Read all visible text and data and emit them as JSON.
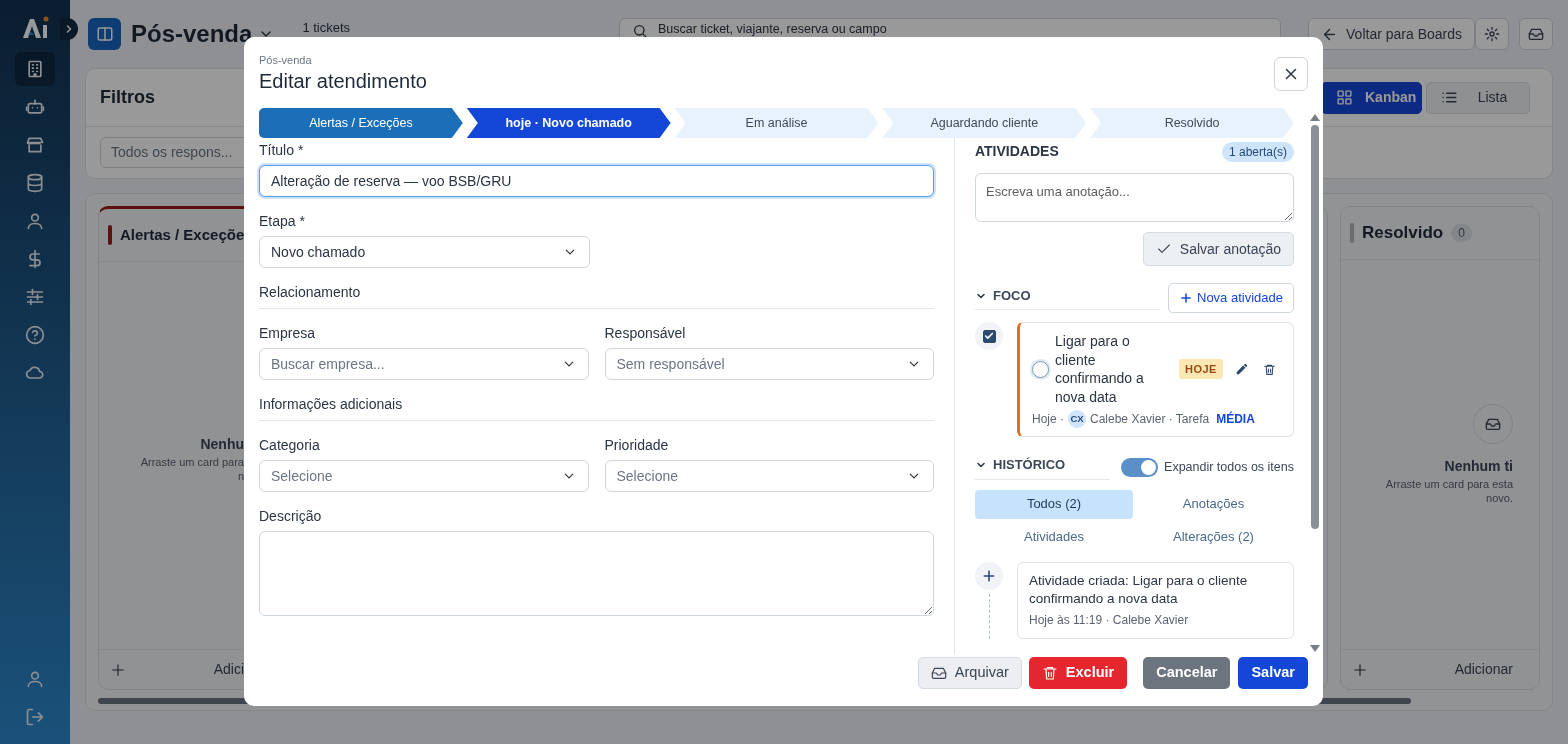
{
  "sidebar": {
    "items": [
      {
        "selected": true
      },
      {
        "selected": false
      },
      {
        "selected": false
      },
      {
        "selected": false
      },
      {
        "selected": false
      },
      {
        "selected": false
      },
      {
        "selected": false
      },
      {
        "selected": false
      },
      {
        "selected": false
      }
    ],
    "bottom_items": [
      {
        "selected": false
      },
      {
        "selected": false
      }
    ]
  },
  "header": {
    "board_title": "Pós-venda",
    "ticket_count": "1 tickets",
    "search_placeholder": "Buscar ticket, viajante, reserva ou campo",
    "back_button": "Voltar para Boards"
  },
  "filters": {
    "title": "Filtros",
    "responsible_select": "Todos os respons...",
    "views": [
      {
        "label": "Kanban",
        "selected": true
      },
      {
        "label": "Lista",
        "selected": false
      }
    ]
  },
  "board": {
    "columns": [
      {
        "title": "Alertas / Exceçõe",
        "color": "#5d1111",
        "empty_title": "Nenhu",
        "empty_lines": [
          "Arraste um card para",
          "n"
        ],
        "add_label": "Adici"
      },
      {
        "title": "Resolvido",
        "count": "0",
        "color": "#686d71",
        "empty_title": "Nenhum ti",
        "empty_lines": [
          "Arraste um card para esta",
          "novo."
        ],
        "add_label": "Adicionar"
      }
    ]
  },
  "modal": {
    "breadcrumb": "Pós-venda",
    "title": "Editar atendimento",
    "steps": [
      {
        "label": "Alertas / Exceções",
        "completed": true,
        "selected": false
      },
      {
        "label": "hoje · Novo chamado",
        "completed": false,
        "selected": true
      },
      {
        "label": "Em análise",
        "completed": false,
        "selected": false
      },
      {
        "label": "Aguardando cliente",
        "completed": false,
        "selected": false
      },
      {
        "label": "Resolvido",
        "completed": false,
        "selected": false
      }
    ],
    "title_field": {
      "label": "Título *",
      "value": "Alteração de reserva — voo BSB/GRU",
      "focused": true
    },
    "stage_field": {
      "label": "Etapa *",
      "value": "Novo chamado"
    },
    "sections": [
      {
        "heading": "Relacionamento",
        "fields": [
          {
            "label": "Empresa",
            "placeholder": "Buscar empresa..."
          },
          {
            "label": "Responsável",
            "placeholder": "Sem responsável"
          }
        ]
      },
      {
        "heading": "Informações adicionais",
        "fields": [
          {
            "label": "Categoria",
            "placeholder": "Selecione"
          },
          {
            "label": "Prioridade",
            "placeholder": "Selecione"
          }
        ]
      }
    ],
    "description_field": {
      "label": "Descrição"
    },
    "activities": {
      "heading": "ATIVIDADES",
      "open_badge": "1 aberta(s)",
      "note_placeholder": "Escreva uma anotação...",
      "save_note_button": "Salvar anotação",
      "focus": {
        "heading": "FOCO",
        "expanded": true,
        "new_button": "Nova atividade",
        "items": [
          {
            "selected": true,
            "done": false,
            "title": "Ligar para o cliente confirmando a nova data",
            "due_badge": "HOJE",
            "date": "Hoje ·",
            "assignee_initials": "CX",
            "assignee": "Calebe Xavier · Tarefa",
            "priority": "MÉDIA"
          }
        ]
      },
      "history": {
        "heading": "HISTÓRICO",
        "expanded": true,
        "expand_all": {
          "label": "Expandir todos os itens",
          "on": true
        },
        "tabs": [
          {
            "label": "Todos (2)",
            "selected": true
          },
          {
            "label": "Anotações",
            "selected": false
          },
          {
            "label": "Atividades",
            "selected": false
          },
          {
            "label": "Alterações (2)",
            "selected": false
          }
        ],
        "entries": [
          {
            "kind": "created",
            "title": "Atividade criada: Ligar para o cliente confirmando a nova data",
            "meta": "Hoje às 11:19 · Calebe Xavier"
          }
        ]
      }
    },
    "footer_buttons": [
      {
        "kind": "archive",
        "label": "Arquivar"
      },
      {
        "kind": "delete",
        "label": "Excluir"
      },
      {
        "kind": "cancel",
        "label": "Cancelar"
      },
      {
        "kind": "save",
        "label": "Salvar"
      }
    ]
  }
}
